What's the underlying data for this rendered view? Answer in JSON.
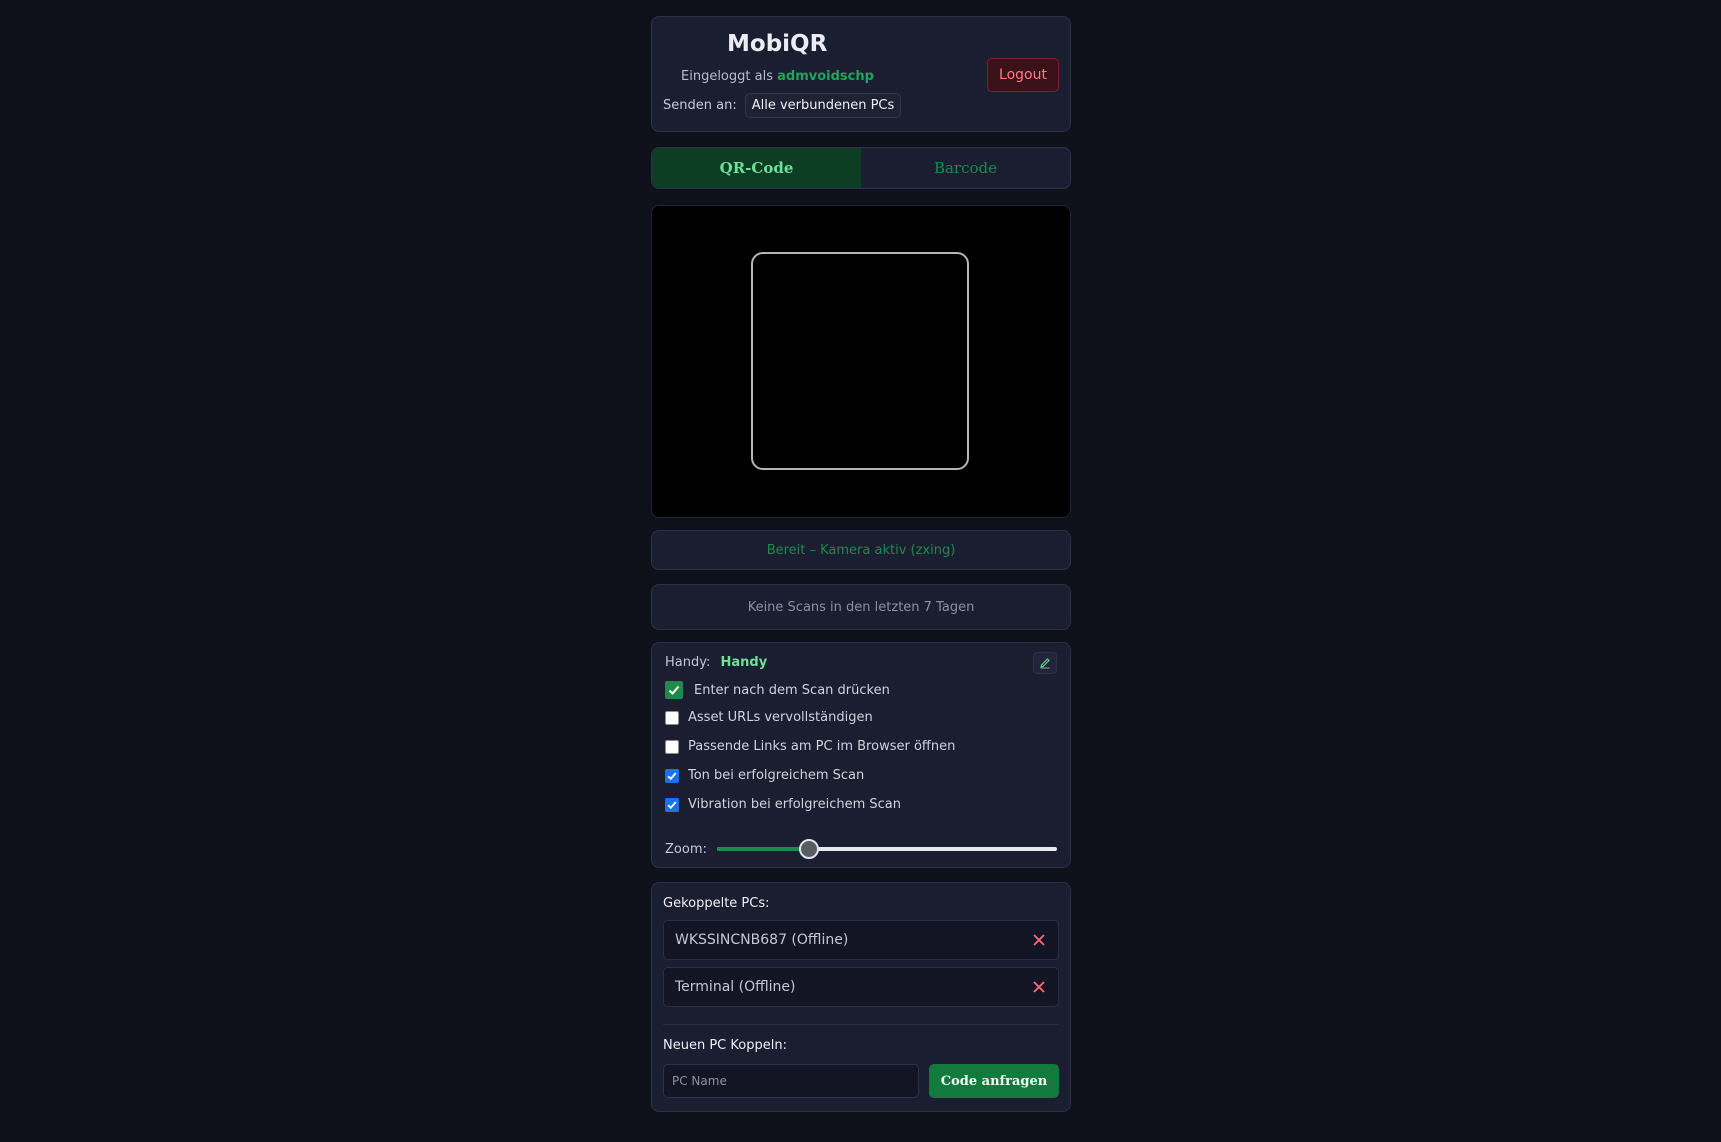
{
  "header": {
    "title": "MobiQR",
    "logged_in_prefix": "Eingeloggt als",
    "username": "admvoidschp",
    "send_label": "Senden an:",
    "send_target": "Alle verbundenen PCs",
    "logout_label": "Logout"
  },
  "tabs": [
    {
      "label": "QR-Code",
      "active": true
    },
    {
      "label": "Barcode",
      "active": false
    }
  ],
  "status_text": "Bereit – Kamera aktiv (zxing)",
  "history_text": "Keine Scans in den letzten 7 Tagen",
  "settings": {
    "device_label": "Handy:",
    "device_name": "Handy",
    "options": [
      {
        "label": "Enter nach dem Scan drücken",
        "checked": true
      },
      {
        "label": "Asset URLs vervollständigen",
        "checked": false
      },
      {
        "label": "Passende Links am PC im Browser öffnen",
        "checked": false
      },
      {
        "label": "Ton bei erfolgreichem Scan",
        "checked": true
      },
      {
        "label": "Vibration bei erfolgreichem Scan",
        "checked": true
      }
    ],
    "zoom_label": "Zoom:",
    "zoom_fraction": 0.27
  },
  "paired": {
    "title": "Gekoppelte PCs:",
    "pcs": [
      {
        "name": "WKSSINCNB687 (Offline)"
      },
      {
        "name": "Terminal (Offline)"
      }
    ],
    "new_title": "Neuen PC Koppeln:",
    "input_placeholder": "PC Name",
    "button_label": "Code anfragen"
  },
  "colors": {
    "accent": "#1f8a4c",
    "background": "#0f111a",
    "danger": "#ff7b86"
  }
}
